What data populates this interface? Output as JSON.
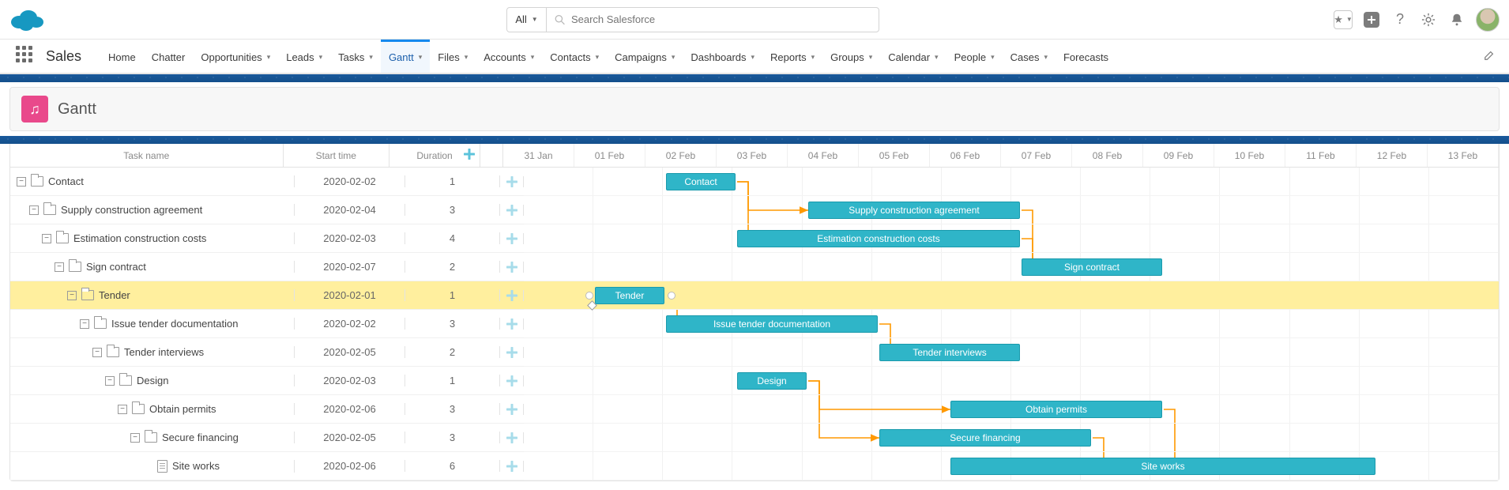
{
  "header": {
    "search_scope": "All",
    "search_placeholder": "Search Salesforce"
  },
  "nav": {
    "app_name": "Sales",
    "tabs": [
      {
        "label": "Home",
        "has_menu": false
      },
      {
        "label": "Chatter",
        "has_menu": false
      },
      {
        "label": "Opportunities",
        "has_menu": true
      },
      {
        "label": "Leads",
        "has_menu": true
      },
      {
        "label": "Tasks",
        "has_menu": true
      },
      {
        "label": "Gantt",
        "has_menu": true,
        "active": true
      },
      {
        "label": "Files",
        "has_menu": true
      },
      {
        "label": "Accounts",
        "has_menu": true
      },
      {
        "label": "Contacts",
        "has_menu": true
      },
      {
        "label": "Campaigns",
        "has_menu": true
      },
      {
        "label": "Dashboards",
        "has_menu": true
      },
      {
        "label": "Reports",
        "has_menu": true
      },
      {
        "label": "Groups",
        "has_menu": true
      },
      {
        "label": "Calendar",
        "has_menu": true
      },
      {
        "label": "People",
        "has_menu": true
      },
      {
        "label": "Cases",
        "has_menu": true
      },
      {
        "label": "Forecasts",
        "has_menu": false
      }
    ]
  },
  "page": {
    "title": "Gantt"
  },
  "gantt": {
    "columns": {
      "task": "Task name",
      "start": "Start time",
      "duration": "Duration"
    },
    "timeline": [
      "31 Jan",
      "01 Feb",
      "02 Feb",
      "03 Feb",
      "04 Feb",
      "05 Feb",
      "06 Feb",
      "07 Feb",
      "08 Feb",
      "09 Feb",
      "10 Feb",
      "11 Feb",
      "12 Feb",
      "13 Feb"
    ],
    "day_width": 90,
    "origin_date": "2020-01-31",
    "tasks": [
      {
        "name": "Contact",
        "start": "2020-02-02",
        "duration": 1,
        "depth": 0,
        "icon": "folder",
        "bar_start": 2,
        "bar_span": 1,
        "highlight": false
      },
      {
        "name": "Supply construction agreement",
        "start": "2020-02-04",
        "duration": 3,
        "depth": 1,
        "icon": "folder",
        "bar_start": 4,
        "bar_span": 3,
        "highlight": false
      },
      {
        "name": "Estimation construction costs",
        "start": "2020-02-03",
        "duration": 4,
        "depth": 2,
        "icon": "folder",
        "bar_start": 3,
        "bar_span": 4,
        "highlight": false
      },
      {
        "name": "Sign contract",
        "start": "2020-02-07",
        "duration": 2,
        "depth": 3,
        "icon": "folder",
        "bar_start": 7,
        "bar_span": 2,
        "highlight": false
      },
      {
        "name": "Tender",
        "start": "2020-02-01",
        "duration": 1,
        "depth": 4,
        "icon": "folder",
        "bar_start": 1,
        "bar_span": 1,
        "highlight": true
      },
      {
        "name": "Issue tender documentation",
        "start": "2020-02-02",
        "duration": 3,
        "depth": 5,
        "icon": "folder",
        "bar_start": 2,
        "bar_span": 3,
        "highlight": false
      },
      {
        "name": "Tender interviews",
        "start": "2020-02-05",
        "duration": 2,
        "depth": 6,
        "icon": "folder",
        "bar_start": 5,
        "bar_span": 2,
        "highlight": false
      },
      {
        "name": "Design",
        "start": "2020-02-03",
        "duration": 1,
        "depth": 7,
        "icon": "folder",
        "bar_start": 3,
        "bar_span": 1,
        "highlight": false
      },
      {
        "name": "Obtain permits",
        "start": "2020-02-06",
        "duration": 3,
        "depth": 8,
        "icon": "folder",
        "bar_start": 6,
        "bar_span": 3,
        "highlight": false
      },
      {
        "name": "Secure financing",
        "start": "2020-02-05",
        "duration": 3,
        "depth": 9,
        "icon": "folder",
        "bar_start": 5,
        "bar_span": 3,
        "highlight": false
      },
      {
        "name": "Site works",
        "start": "2020-02-06",
        "duration": 6,
        "depth": 10,
        "icon": "doc",
        "bar_start": 6,
        "bar_span": 6,
        "highlight": false,
        "leaf": true
      }
    ],
    "dependencies": [
      {
        "from": 0,
        "to": 1
      },
      {
        "from": 0,
        "to": 2
      },
      {
        "from": 1,
        "to": 3
      },
      {
        "from": 2,
        "to": 3
      },
      {
        "from": 4,
        "to": 5
      },
      {
        "from": 5,
        "to": 6
      },
      {
        "from": 7,
        "to": 8
      },
      {
        "from": 7,
        "to": 9
      },
      {
        "from": 8,
        "to": 10
      },
      {
        "from": 9,
        "to": 10
      }
    ]
  }
}
